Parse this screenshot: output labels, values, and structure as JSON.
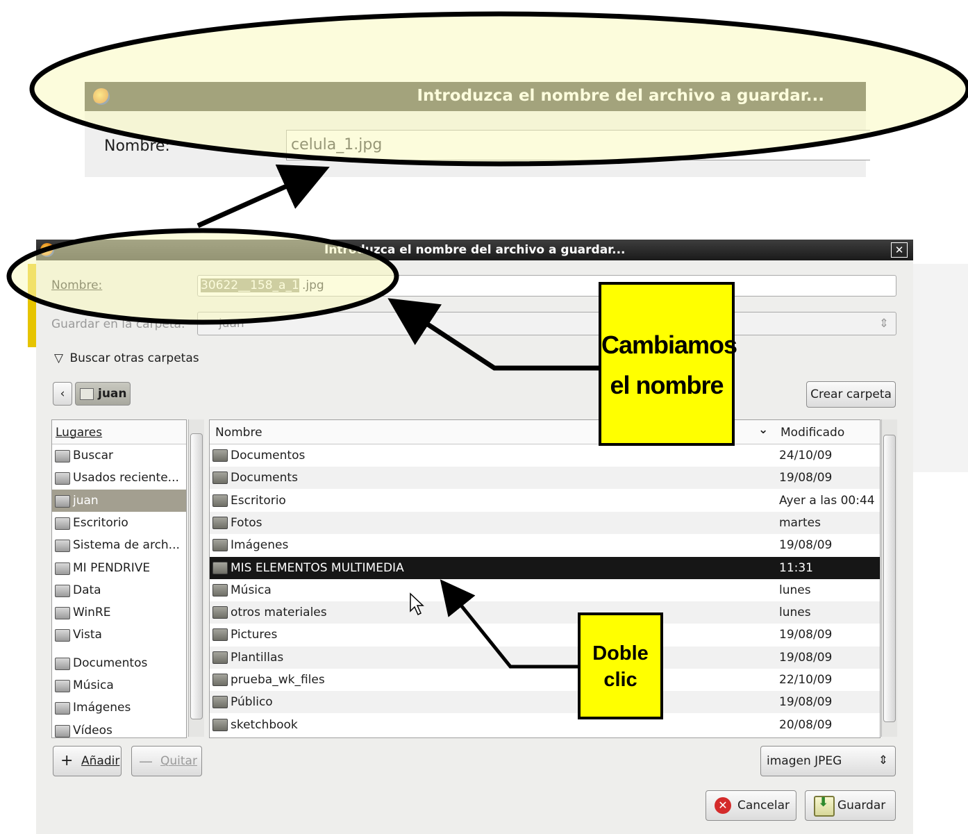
{
  "zoom_snippet": {
    "title": "Introduzca el nombre del archivo a guardar...",
    "name_label": "Nombre:",
    "name_value": "celula_1.jpg"
  },
  "dialog": {
    "title": "Introduzca el nombre del archivo a guardar...",
    "close_glyph": "✕",
    "name_label": "Nombre:",
    "name_value_selected": "30622__158_a_1",
    "name_value_ext": ".jpg",
    "save_in_label": "Guardar en la carpeta:",
    "save_in_value": "juan",
    "browse_toggle": "Buscar otras carpetas",
    "back_glyph": "‹",
    "path_button": "juan",
    "create_folder_button": "Crear carpeta",
    "places_header": "Lugares",
    "places": [
      {
        "label": "Buscar",
        "icon": "binoculars-icon"
      },
      {
        "label": "Usados reciente...",
        "icon": "recent-icon"
      },
      {
        "label": "juan",
        "icon": "home-folder-icon",
        "selected": true
      },
      {
        "label": "Escritorio",
        "icon": "desktop-icon"
      },
      {
        "label": "Sistema de arch...",
        "icon": "filesystem-icon"
      },
      {
        "label": "MI PENDRIVE",
        "icon": "drive-icon"
      },
      {
        "label": "Data",
        "icon": "drive-icon"
      },
      {
        "label": "WinRE",
        "icon": "drive-icon"
      },
      {
        "label": "Vista",
        "icon": "drive-icon"
      },
      {
        "label": "Documentos",
        "icon": "folder-icon"
      },
      {
        "label": "Música",
        "icon": "folder-icon"
      },
      {
        "label": "Imágenes",
        "icon": "folder-icon"
      },
      {
        "label": "Vídeos",
        "icon": "folder-icon"
      }
    ],
    "columns": {
      "name": "Nombre",
      "modified": "Modificado",
      "sort_glyph": "⌄"
    },
    "files": [
      {
        "name": "Documentos",
        "modified": "24/10/09"
      },
      {
        "name": "Documents",
        "modified": "19/08/09"
      },
      {
        "name": "Escritorio",
        "modified": "Ayer a las 00:44"
      },
      {
        "name": "Fotos",
        "modified": "martes"
      },
      {
        "name": "Imágenes",
        "modified": "19/08/09"
      },
      {
        "name": "MIS ELEMENTOS MULTIMEDIA",
        "modified": "11:31",
        "selected": true
      },
      {
        "name": "Música",
        "modified": "lunes"
      },
      {
        "name": "otros materiales",
        "modified": "lunes"
      },
      {
        "name": "Pictures",
        "modified": "19/08/09"
      },
      {
        "name": "Plantillas",
        "modified": "19/08/09"
      },
      {
        "name": "prueba_wk_files",
        "modified": "22/10/09"
      },
      {
        "name": "Público",
        "modified": "19/08/09"
      },
      {
        "name": "sketchbook",
        "modified": "20/08/09"
      }
    ],
    "add_button": "Añadir",
    "remove_button": "Quitar",
    "filetype_value": "imagen JPEG",
    "cancel_button": "Cancelar",
    "save_button": "Guardar"
  },
  "callouts": {
    "rename": "Cambiamos el nombre",
    "double_click": "Doble clic"
  },
  "colors": {
    "highlight_ellipse": "#fafac0",
    "callout_bg": "#ffff00",
    "titlebar": "#1a1a1a",
    "selected_row": "#161616"
  }
}
